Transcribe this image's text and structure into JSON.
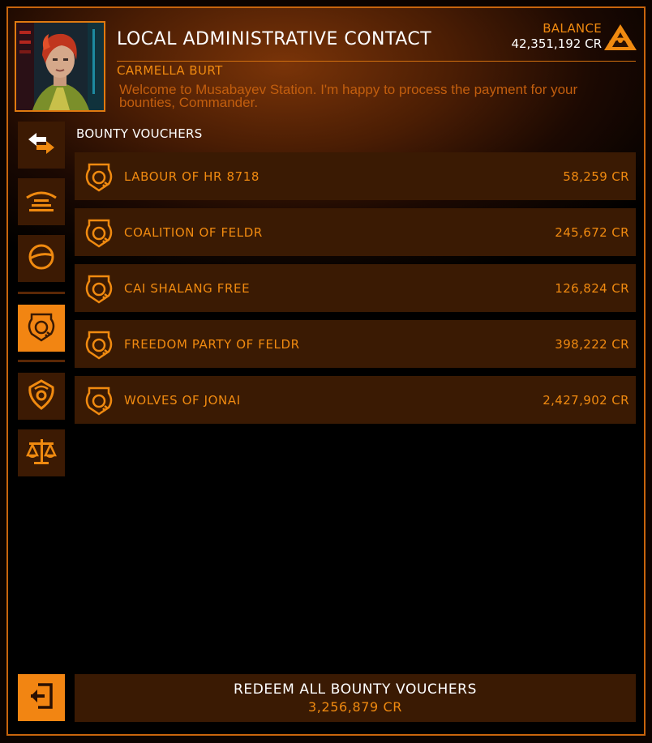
{
  "header": {
    "title": "LOCAL ADMINISTRATIVE CONTACT",
    "npc_name": "CARMELLA BURT",
    "npc_message": "Welcome to Musabayev Station. I'm happy to process the payment for your bounties, Commander.",
    "balance_label": "BALANCE",
    "balance_value": "42,351,192 CR",
    "faction_icon": "triangle-faction-icon"
  },
  "sidebar": {
    "tabs": [
      {
        "icon": "transfer-arrows-icon",
        "active": false
      },
      {
        "icon": "hangar-bay-icon",
        "active": false
      },
      {
        "icon": "orbit-icon",
        "active": false
      },
      {
        "icon": "bounty-voucher-icon",
        "active": true
      },
      {
        "icon": "shield-badge-icon",
        "active": false
      },
      {
        "icon": "scales-icon",
        "active": false
      }
    ]
  },
  "vouchers": {
    "section_label": "BOUNTY VOUCHERS",
    "items": [
      {
        "faction": "LABOUR OF HR 8718",
        "amount": "58,259 CR"
      },
      {
        "faction": "COALITION OF FELDR",
        "amount": "245,672 CR"
      },
      {
        "faction": "CAI SHALANG FREE",
        "amount": "126,824 CR"
      },
      {
        "faction": "FREEDOM PARTY OF FELDR",
        "amount": "398,222 CR"
      },
      {
        "faction": "WOLVES OF JONAI",
        "amount": "2,427,902 CR"
      }
    ]
  },
  "footer": {
    "redeem_label": "REDEEM ALL BOUNTY VOUCHERS",
    "redeem_total": "3,256,879 CR",
    "exit_icon": "exit-icon"
  },
  "colors": {
    "accent": "#f08a10",
    "panel": "#3a1a03",
    "active": "#f28512",
    "text_primary": "#ffffff"
  }
}
